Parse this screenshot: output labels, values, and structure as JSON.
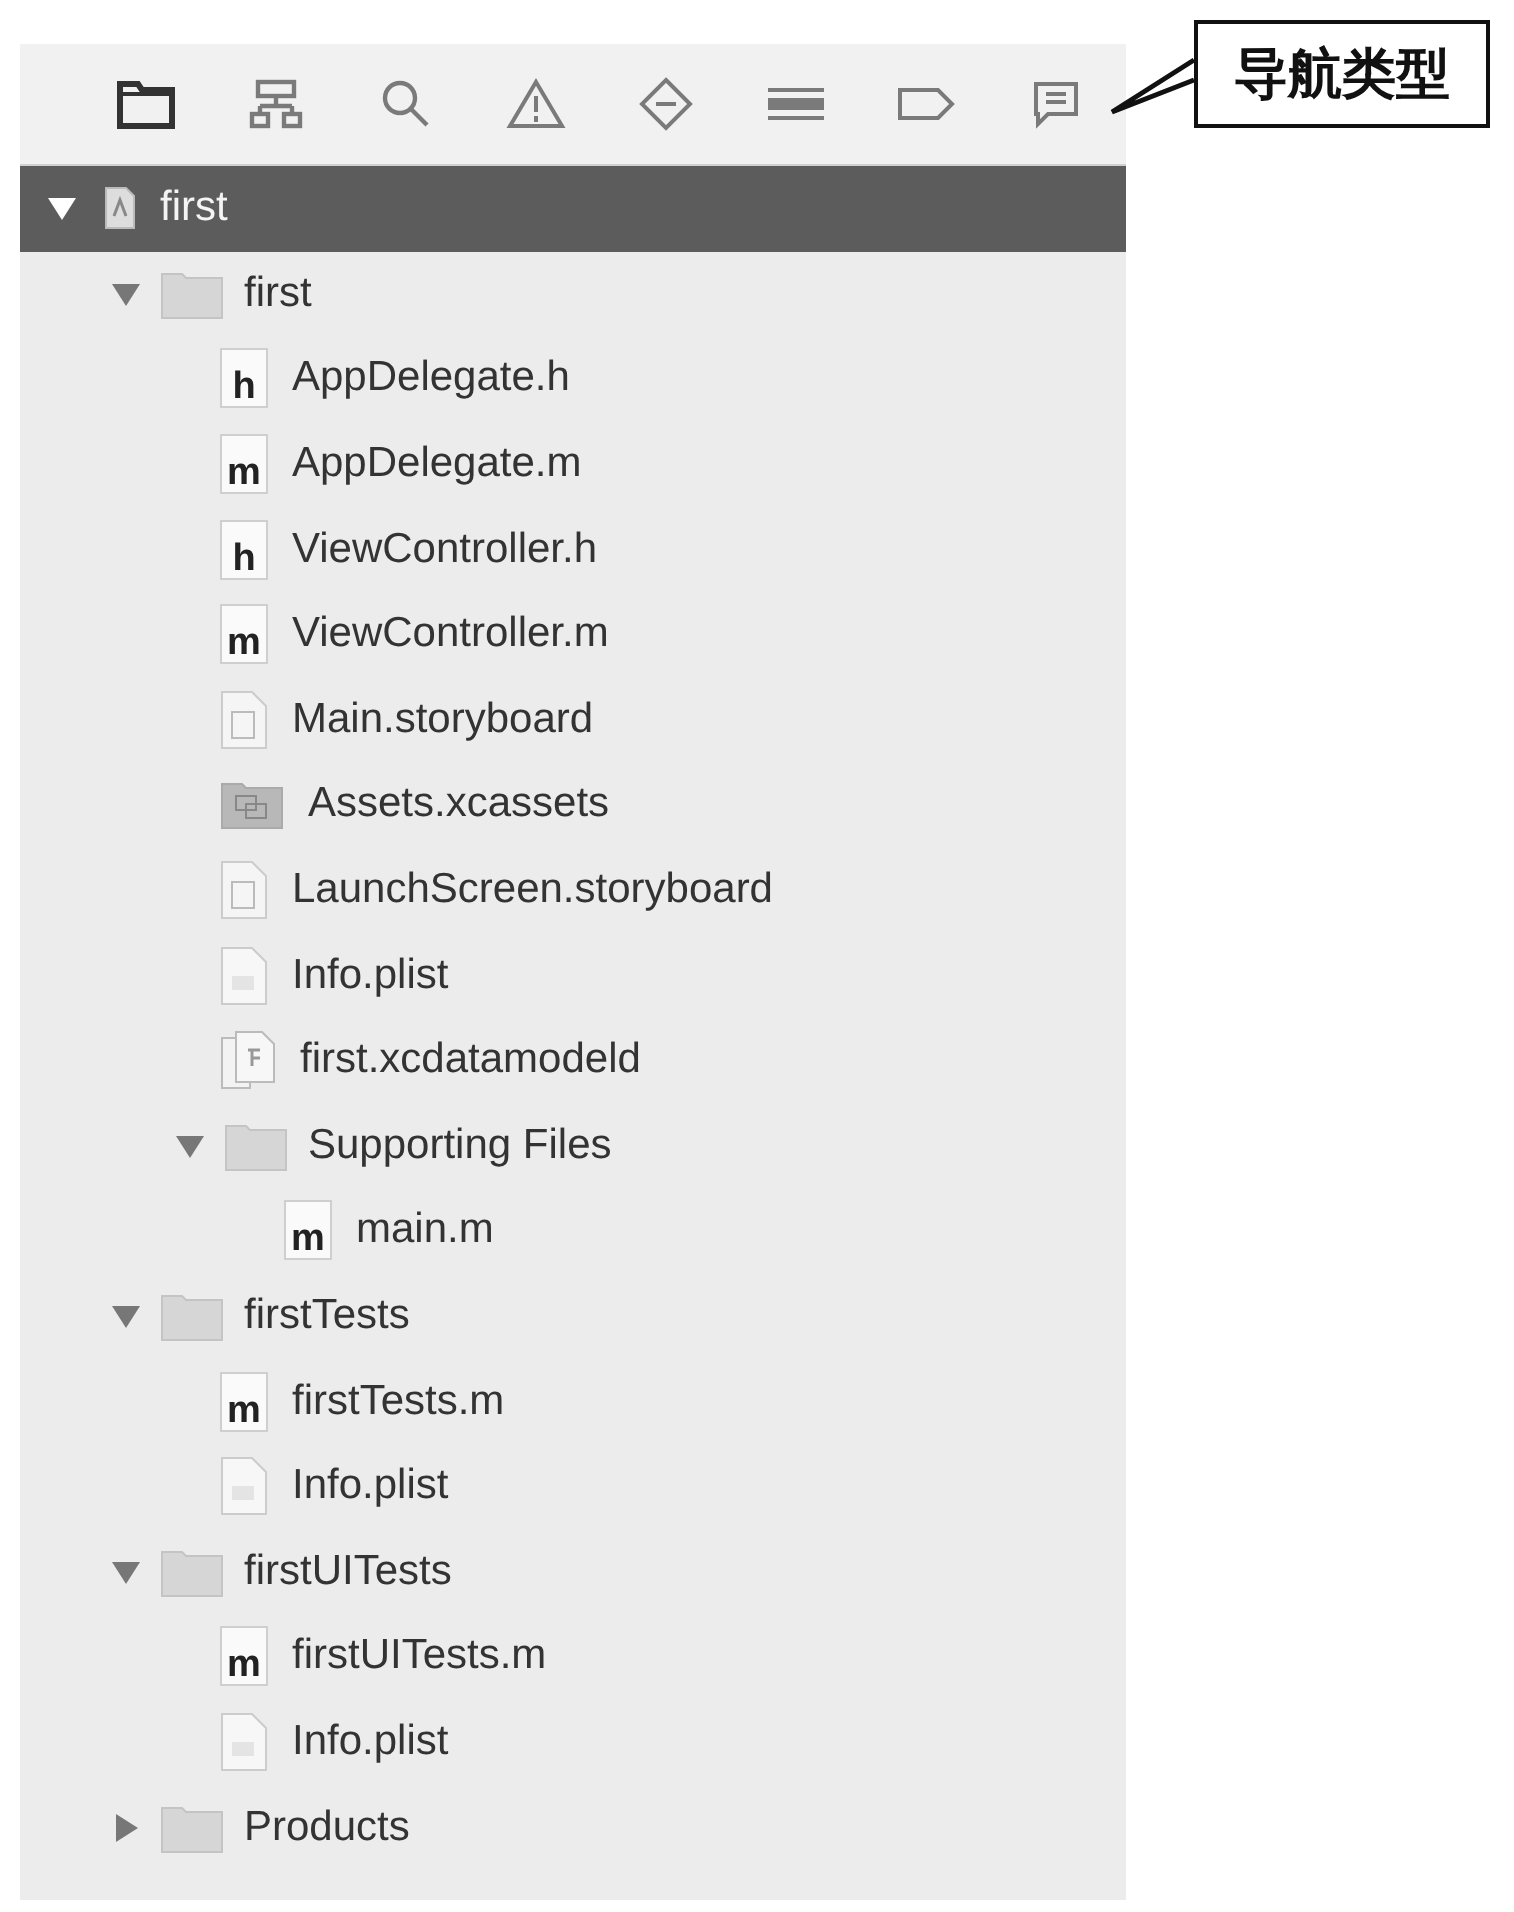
{
  "navigator_tabs": [
    {
      "kind": "project",
      "selected": true
    },
    {
      "kind": "symbol",
      "selected": false
    },
    {
      "kind": "find",
      "selected": false
    },
    {
      "kind": "issue",
      "selected": false
    },
    {
      "kind": "test",
      "selected": false
    },
    {
      "kind": "debug",
      "selected": false
    },
    {
      "kind": "breakpoint",
      "selected": false
    },
    {
      "kind": "report",
      "selected": false
    }
  ],
  "callout": {
    "text": "导航类型"
  },
  "tree": [
    {
      "kind": "project",
      "label": "first",
      "expanded": true,
      "selected": true,
      "children": [
        {
          "kind": "folder",
          "label": "first",
          "expanded": true,
          "selected": false,
          "children": [
            {
              "kind": "source",
              "badge": "h",
              "label": "AppDelegate.h",
              "selected": false
            },
            {
              "kind": "source",
              "badge": "m",
              "label": "AppDelegate.m",
              "selected": false
            },
            {
              "kind": "source",
              "badge": "h",
              "label": "ViewController.h",
              "selected": false
            },
            {
              "kind": "source",
              "badge": "m",
              "label": "ViewController.m",
              "selected": false
            },
            {
              "kind": "storyboard",
              "label": "Main.storyboard",
              "selected": false
            },
            {
              "kind": "assets",
              "label": "Assets.xcassets",
              "selected": false
            },
            {
              "kind": "storyboard",
              "label": "LaunchScreen.storyboard",
              "selected": false
            },
            {
              "kind": "plist",
              "label": "Info.plist",
              "selected": false
            },
            {
              "kind": "datamodel",
              "label": "first.xcdatamodeld",
              "selected": false
            },
            {
              "kind": "folder",
              "label": "Supporting Files",
              "expanded": true,
              "selected": false,
              "children": [
                {
                  "kind": "source",
                  "badge": "m",
                  "label": "main.m",
                  "selected": false
                }
              ]
            }
          ]
        },
        {
          "kind": "folder",
          "label": "firstTests",
          "expanded": true,
          "selected": false,
          "children": [
            {
              "kind": "source",
              "badge": "m",
              "label": "firstTests.m",
              "selected": false
            },
            {
              "kind": "plist",
              "label": "Info.plist",
              "selected": false
            }
          ]
        },
        {
          "kind": "folder",
          "label": "firstUITests",
          "expanded": true,
          "selected": false,
          "children": [
            {
              "kind": "source",
              "badge": "m",
              "label": "firstUITests.m",
              "selected": false
            },
            {
              "kind": "plist",
              "label": "Info.plist",
              "selected": false
            }
          ]
        },
        {
          "kind": "folder",
          "label": "Products",
          "expanded": false,
          "selected": false
        }
      ]
    }
  ]
}
